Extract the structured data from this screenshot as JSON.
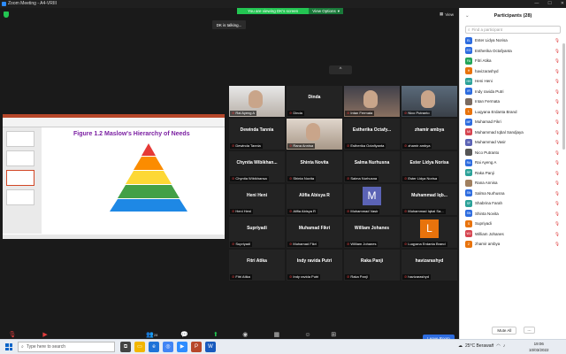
{
  "window": {
    "title": "Zoom Meeting - A4-VRIII",
    "minimize": "—",
    "maximize": "☐",
    "close": "✕"
  },
  "banner": {
    "viewing_text": "You are viewing DK's screen",
    "view_options": "View Options",
    "options_chevron": "▾"
  },
  "talking": "DK is talking...",
  "view_button": "View",
  "collapse_glyph": "^",
  "shared_slide": {
    "title": "Figure 1.2 Maslow's Hierarchy of Needs"
  },
  "tiles": [
    {
      "name": "",
      "label": "Rai Ayeng A",
      "kind": "video",
      "style": "v1"
    },
    {
      "name": "Dinda",
      "label": "Dinda",
      "kind": "name"
    },
    {
      "name": "",
      "label": "Intan Fermata",
      "kind": "video",
      "style": "v2"
    },
    {
      "name": "",
      "label": "Nico Putranto",
      "kind": "video",
      "style": "v3"
    },
    {
      "name": "Dewinda Tannia",
      "label": "Dewinda Tannia",
      "kind": "name"
    },
    {
      "name": "",
      "label": "Rana Annisa",
      "kind": "video",
      "style": "v4"
    },
    {
      "name": "Estherika Octafy...",
      "label": "Estherika Octafiyanta",
      "kind": "name"
    },
    {
      "name": "zhamir ambya",
      "label": "zhamir ambya",
      "kind": "name"
    },
    {
      "name": "Chyntia Wibikhan...",
      "label": "Chyntia Wibikhansa",
      "kind": "name"
    },
    {
      "name": "Shinta Novita",
      "label": "Shinta Novita",
      "kind": "name"
    },
    {
      "name": "Salma Nurhusna",
      "label": "Salma Nurhusna",
      "kind": "name"
    },
    {
      "name": "Ester Lidya Norisa",
      "label": "Ester Lidya Norisa",
      "kind": "name"
    },
    {
      "name": "Heni Heni",
      "label": "Heni Heni",
      "kind": "name"
    },
    {
      "name": "Alifia Abisya R",
      "label": "Alifia Abisya R",
      "kind": "name"
    },
    {
      "name": "",
      "label": "Muhammad Vasir",
      "kind": "avatar",
      "letter": "M",
      "color": "#5b63b5"
    },
    {
      "name": "Muhammad Iqb...",
      "label": "Muhammad Iqbal Sa...",
      "kind": "name"
    },
    {
      "name": "Supriyadi",
      "label": "Supriyadi",
      "kind": "name"
    },
    {
      "name": "Muhamad Fikri",
      "label": "Muhamad Fikri",
      "kind": "name"
    },
    {
      "name": "William Johanes",
      "label": "William Johanes",
      "kind": "name"
    },
    {
      "name": "",
      "label": "Luqyana Erdanta Brand",
      "kind": "avatar",
      "letter": "L",
      "color": "#e8730c"
    },
    {
      "name": "Fitri Atika",
      "label": "Fitri Atika",
      "kind": "name"
    },
    {
      "name": "Indy ravida Putri",
      "label": "Indy ravida Putri",
      "kind": "name"
    },
    {
      "name": "Raka Panji",
      "label": "Raka Panji",
      "kind": "name"
    },
    {
      "name": "havizarashyd",
      "label": "havizarashyd",
      "kind": "name"
    }
  ],
  "panel": {
    "title": "Participants (28)",
    "popout": "⌄",
    "search_placeholder": "Find a participant",
    "mute_all": "Mute All",
    "more": "...",
    "participants": [
      {
        "initials": "EL",
        "name": "Ester Lidya Norisa",
        "color": "#2d6cdf"
      },
      {
        "initials": "EO",
        "name": "Estherika Octafyanta",
        "color": "#2d6cdf"
      },
      {
        "initials": "FA",
        "name": "Fitri Atika",
        "color": "#23a559"
      },
      {
        "initials": "H",
        "name": "havizarashyd",
        "color": "#e8730c"
      },
      {
        "initials": "HH",
        "name": "Heni Heni",
        "color": "#2aa198"
      },
      {
        "initials": "IR",
        "name": "Indy ravida Putri",
        "color": "#2d6cdf"
      },
      {
        "initials": "",
        "name": "Intan Fermata",
        "color": "#7a6a60"
      },
      {
        "initials": "L",
        "name": "Luqyana Erdanta Brand",
        "color": "#e8730c"
      },
      {
        "initials": "MF",
        "name": "Muhamad Fikri",
        "color": "#2d6cdf"
      },
      {
        "initials": "MI",
        "name": "Muhammad Iqbal Sandjaya",
        "color": "#d64550"
      },
      {
        "initials": "M",
        "name": "Muhammad Vasir",
        "color": "#5b63b5"
      },
      {
        "initials": "",
        "name": "Nico Putranto",
        "color": "#555"
      },
      {
        "initials": "RA",
        "name": "Rai Ayeng A",
        "color": "#2d6cdf"
      },
      {
        "initials": "RP",
        "name": "Raka Panji",
        "color": "#2aa198"
      },
      {
        "initials": "",
        "name": "Rana Annisa",
        "color": "#a08060"
      },
      {
        "initials": "SN",
        "name": "Salma Nurhusna",
        "color": "#2d6cdf"
      },
      {
        "initials": "SF",
        "name": "Shabrina Farah",
        "color": "#2aa198"
      },
      {
        "initials": "SN",
        "name": "Shinta Novita",
        "color": "#2d6cdf"
      },
      {
        "initials": "S",
        "name": "Supriyadi",
        "color": "#e8730c"
      },
      {
        "initials": "WJ",
        "name": "William Johanes",
        "color": "#d64550"
      },
      {
        "initials": "Z",
        "name": "zhamir ambya",
        "color": "#e8730c"
      }
    ]
  },
  "toolbar": {
    "unmute": "Unmute",
    "start_video": "Start Video",
    "participants": "Participants",
    "participants_count": "28",
    "chat": "Chat",
    "share_screen": "Share Screen",
    "record": "Record",
    "breakout_rooms": "Breakout Rooms",
    "reactions": "Reactions",
    "apps": "Apps",
    "end_room": "Leave Room"
  },
  "taskbar": {
    "search_placeholder": "Type here to search",
    "weather": "25°C  Berawan",
    "time": "19:06",
    "date": "10/03/2022"
  }
}
